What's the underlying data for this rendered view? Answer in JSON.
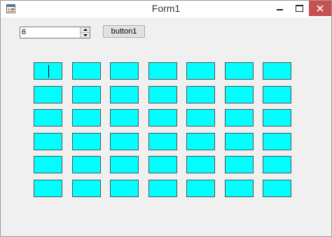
{
  "window": {
    "title": "Form1",
    "icons": {
      "app": "form-app-icon",
      "minimize": "minimize-icon",
      "maximize": "maximize-icon",
      "close": "close-icon"
    },
    "colors": {
      "close_button": "#c75050",
      "client_background": "#f0f0f0"
    }
  },
  "form": {
    "numeric_value": "6",
    "button_label": "button1"
  },
  "grid": {
    "rows": 6,
    "columns": 7,
    "cell_color": "#00ffff",
    "focused_cell": 0
  }
}
